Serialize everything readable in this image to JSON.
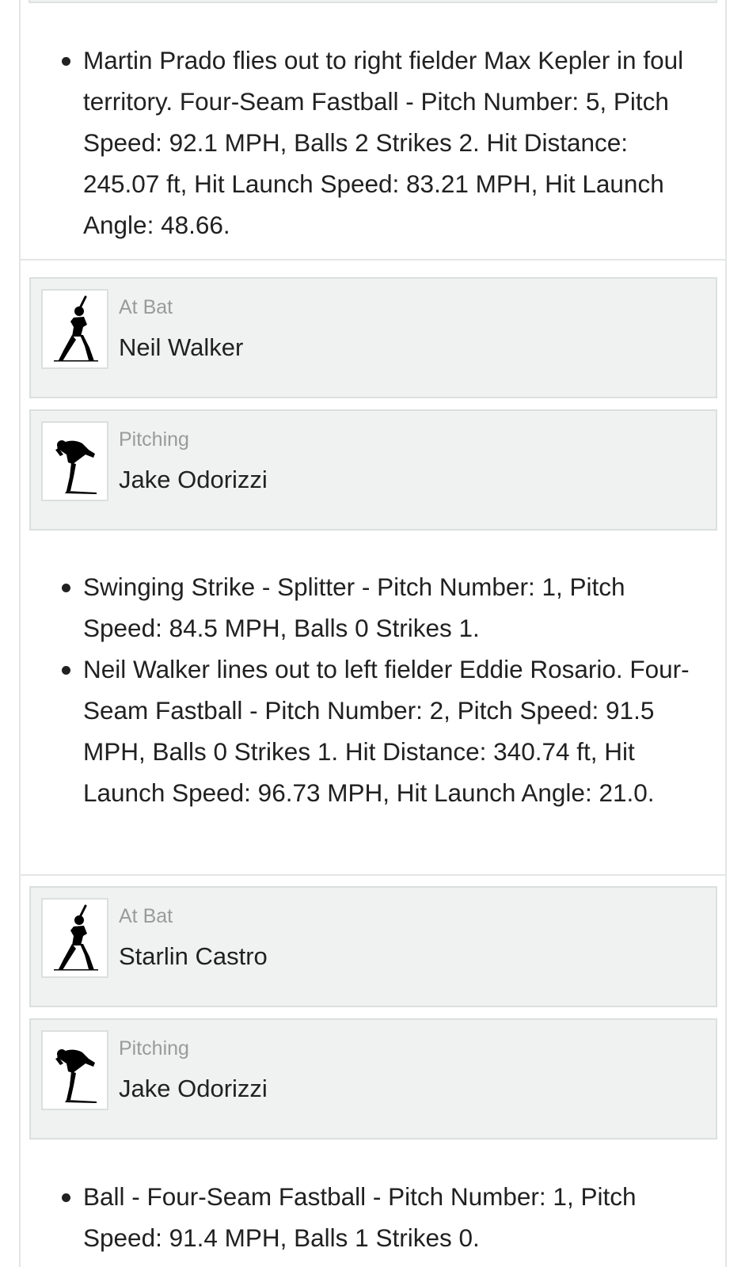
{
  "plays_section_1": [
    {
      "text": "Martin Prado flies out to right fielder Max Kepler in foul territory. Four-Seam Fastball - Pitch Number: 5, Pitch Speed: 92.1 MPH, Balls 2 Strikes 2. Hit Distance: 245.07 ft, Hit Launch Speed: 83.21 MPH, Hit Launch Angle: 48.66."
    }
  ],
  "matchup_1": {
    "at_bat": {
      "role": "At Bat",
      "name": "Neil Walker",
      "icon": "batter-icon"
    },
    "pitching": {
      "role": "Pitching",
      "name": "Jake Odorizzi",
      "icon": "pitcher-icon"
    }
  },
  "plays_section_2": [
    {
      "text": "Swinging Strike - Splitter - Pitch Number: 1, Pitch Speed: 84.5 MPH, Balls 0 Strikes 1."
    },
    {
      "text": "Neil Walker lines out to left fielder Eddie Rosario. Four-Seam Fastball - Pitch Number: 2, Pitch Speed: 91.5 MPH, Balls 0 Strikes 1. Hit Distance: 340.74 ft, Hit Launch Speed: 96.73 MPH, Hit Launch Angle: 21.0."
    }
  ],
  "matchup_2": {
    "at_bat": {
      "role": "At Bat",
      "name": "Starlin Castro",
      "icon": "batter-icon"
    },
    "pitching": {
      "role": "Pitching",
      "name": "Jake Odorizzi",
      "icon": "pitcher-icon"
    }
  },
  "plays_section_3": [
    {
      "text": "Ball - Four-Seam Fastball - Pitch Number: 1, Pitch Speed: 91.4 MPH, Balls 1 Strikes 0."
    }
  ],
  "colors": {
    "card_background": "#f0f2f2",
    "card_border": "#dcdfdf",
    "label_gray": "#9a9a9a",
    "text": "#212121"
  }
}
